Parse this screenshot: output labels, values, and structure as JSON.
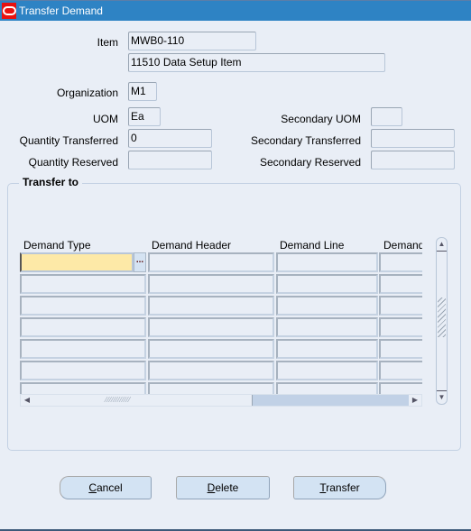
{
  "window": {
    "title": "Transfer Demand",
    "icon": "oracle-logo-icon"
  },
  "form": {
    "item": {
      "label": "Item",
      "value": "MWB0-110",
      "description": "11510 Data Setup Item"
    },
    "organization": {
      "label": "Organization",
      "value": "M1"
    },
    "uom": {
      "label": "UOM",
      "value": "Ea"
    },
    "secondary_uom": {
      "label": "Secondary UOM",
      "value": ""
    },
    "quantity_transferred": {
      "label": "Quantity Transferred",
      "value": "0"
    },
    "secondary_transferred": {
      "label": "Secondary Transferred",
      "value": ""
    },
    "quantity_reserved": {
      "label": "Quantity Reserved",
      "value": ""
    },
    "secondary_reserved": {
      "label": "Secondary Reserved",
      "value": ""
    }
  },
  "transfer_to": {
    "title": "Transfer to",
    "columns": [
      "Demand Type",
      "Demand Header",
      "Demand Line",
      "Demand"
    ],
    "rows": [
      [
        "",
        "",
        "",
        ""
      ],
      [
        "",
        "",
        "",
        ""
      ],
      [
        "",
        "",
        "",
        ""
      ],
      [
        "",
        "",
        "",
        ""
      ],
      [
        "",
        "",
        "",
        ""
      ],
      [
        "",
        "",
        "",
        ""
      ],
      [
        "",
        "",
        "",
        ""
      ]
    ],
    "lov_label": "..."
  },
  "buttons": {
    "cancel": {
      "mnemonic": "C",
      "rest": "ancel"
    },
    "delete": {
      "mnemonic": "D",
      "rest": "elete"
    },
    "transfer": {
      "mnemonic": "T",
      "rest": "ransfer"
    }
  },
  "scroll": {
    "up": "▲",
    "down": "▼",
    "left": "◀",
    "right": "▶",
    "grip": "⁄⁄⁄⁄⁄⁄⁄⁄⁄⁄⁄⁄"
  }
}
